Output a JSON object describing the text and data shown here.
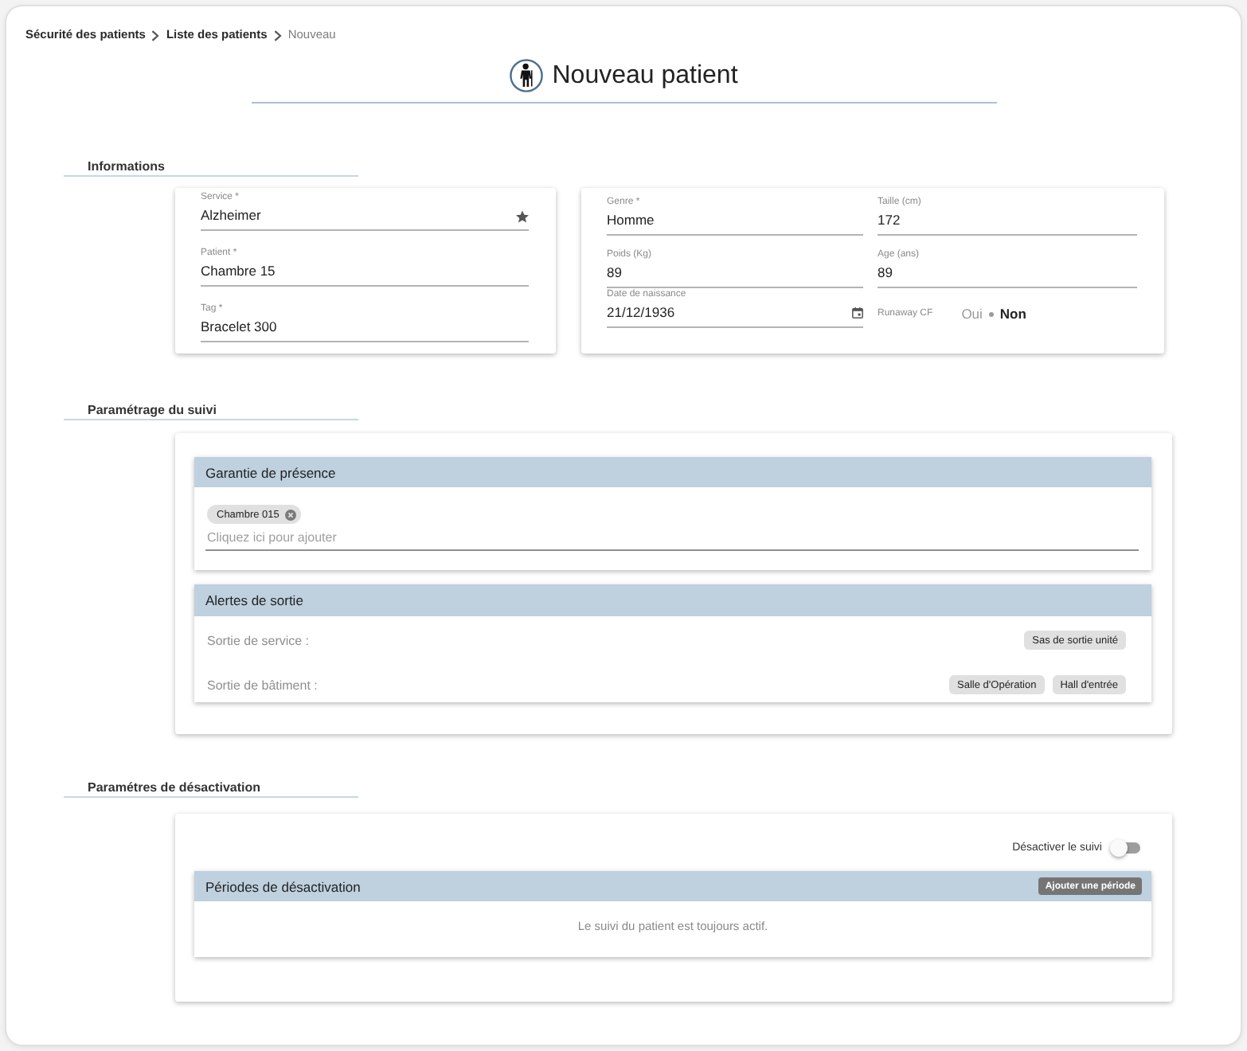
{
  "breadcrumb": [
    {
      "label": "Sécurité des patients",
      "current": false
    },
    {
      "label": "Liste des patients",
      "current": false
    },
    {
      "label": "Nouveau",
      "current": true
    }
  ],
  "page_title": "Nouveau patient",
  "informations": {
    "heading": "Informations",
    "identity_fields": [
      {
        "kind": "starred",
        "label": "Service *",
        "value": "Alzheimer"
      },
      {
        "kind": "text",
        "label": "Patient *",
        "value": "Chambre 15"
      },
      {
        "kind": "text",
        "label": "Tag *",
        "value": "Bracelet 300"
      }
    ],
    "details_fields": [
      {
        "kind": "text",
        "label": "Genre *",
        "value": "Homme"
      },
      {
        "kind": "text",
        "label": "Taille (cm)",
        "value": "172"
      },
      {
        "kind": "text",
        "label": "Poids (Kg)",
        "value": "89"
      },
      {
        "kind": "text",
        "label": "Age (ans)",
        "value": "89"
      },
      {
        "kind": "date",
        "label": "Date de naissance",
        "value": "21/12/1936"
      },
      {
        "kind": "choice",
        "label": "Runaway CF",
        "options": [
          {
            "label": "Oui",
            "selected": false
          },
          {
            "label": "Non",
            "selected": true
          }
        ]
      }
    ]
  },
  "monitoring": {
    "heading": "Paramétrage du suivi",
    "presence": {
      "title": "Garantie de présence",
      "chips": [
        "Chambre 015"
      ],
      "placeholder": "Cliquez ici pour ajouter"
    },
    "exit_alerts": {
      "title": "Alertes de sortie",
      "rows": [
        {
          "label": "Sortie de service :",
          "chips": [
            "Sas de sortie unité"
          ]
        },
        {
          "label": "Sortie de bâtiment :",
          "chips": [
            "Salle d'Opération",
            "Hall d'entrée"
          ]
        }
      ]
    }
  },
  "deactivation": {
    "heading": "Paramétres de désactivation",
    "toggle": {
      "label": "Désactiver le suivi",
      "on": false
    },
    "periods": {
      "title": "Périodes de désactivation",
      "button": "Ajouter une période",
      "empty_message": "Le suivi du patient est toujours actif."
    }
  }
}
